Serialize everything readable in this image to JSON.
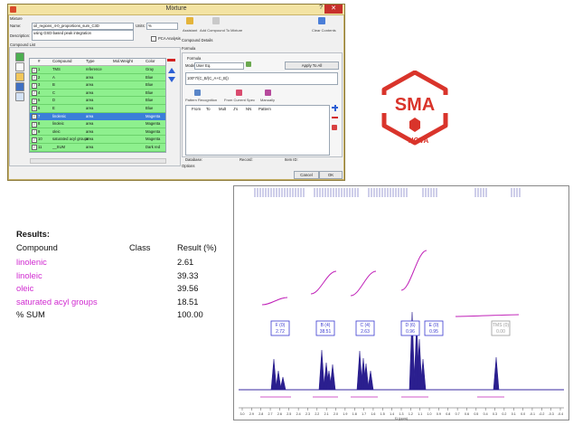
{
  "dialog": {
    "title": "Mixture",
    "help": "?",
    "close": "✕",
    "mixture_group": "Mixture",
    "name_label": "Name:",
    "name_value": "oil_regions_4-0_proportions_sum_C3D",
    "units_label": "Units:",
    "units_value": "%",
    "description_label": "Description:",
    "description_value": "using GSD-based peak integration",
    "pca_label": "PCA Analysis",
    "compound_list_label": "Compound List",
    "toolbar": {
      "assistant": "Assistant",
      "add_compound": "Add Compound To Mixture",
      "clear_contents": "Clear Contents"
    },
    "compound_details": "Compound Details",
    "formula": "Formula",
    "table_headers": {
      "num": "#",
      "compound": "Compound",
      "type": "Type",
      "molweight": "Mol.Weight",
      "color": "Color"
    },
    "rows": [
      {
        "num": "1",
        "compound": "TMS",
        "type": "reference",
        "color": "Gray"
      },
      {
        "num": "2",
        "compound": "A",
        "type": "area",
        "color": "Blue"
      },
      {
        "num": "3",
        "compound": "B",
        "type": "area",
        "color": "Blue"
      },
      {
        "num": "4",
        "compound": "C",
        "type": "area",
        "color": "Blue"
      },
      {
        "num": "5",
        "compound": "D",
        "type": "area",
        "color": "Blue"
      },
      {
        "num": "6",
        "compound": "E",
        "type": "area",
        "color": "Blue"
      },
      {
        "num": "7",
        "compound": "linolenic",
        "type": "area",
        "color": "Magenta"
      },
      {
        "num": "8",
        "compound": "linoleic",
        "type": "area",
        "color": "Magenta"
      },
      {
        "num": "9",
        "compound": "oleic",
        "type": "area",
        "color": "Magenta"
      },
      {
        "num": "10",
        "compound": "saturated acyl groups",
        "type": "area",
        "color": "Magenta"
      },
      {
        "num": "11",
        "compound": "__SUM",
        "type": "area",
        "color": "Dark red"
      }
    ],
    "formula_panel": {
      "formula_label": "Formula",
      "mode_label": "Mode:",
      "mode_value": "User Eq.",
      "apply_all": "Apply To All",
      "formula_text": "100*7/(C_B/(C_A+C_B))",
      "pattern_recognition": "Pattern Recognition",
      "from_current_spec": "From Current Spec",
      "manually": "Manually",
      "cols": [
        "From",
        "To",
        "Mult",
        "J's",
        "NN",
        "Pattern"
      ],
      "database_label": "Database:",
      "record_label": "Record:",
      "item_label": "Item ID:"
    },
    "options_label": "Options",
    "cancel": "Cancel",
    "ok": "OK"
  },
  "logo": {
    "text": "SMA",
    "sub": "NOVA",
    "color": "#d9342b"
  },
  "results": {
    "heading": "Results:",
    "headers": {
      "compound": "Compound",
      "class": "Class",
      "result": "Result (%)"
    },
    "rows": [
      {
        "compound": "linolenic",
        "result": "2.61",
        "highlight": true
      },
      {
        "compound": "linoleic",
        "result": "39.33",
        "highlight": true
      },
      {
        "compound": "oleic",
        "result": "39.56",
        "highlight": true
      },
      {
        "compound": "saturated acyl groups",
        "result": "18.51",
        "highlight": true
      },
      {
        "compound": "% SUM",
        "result": "100.00",
        "highlight": false
      }
    ]
  },
  "spectrum": {
    "box_labels": [
      {
        "top": "F (0)",
        "bottom": "2.72"
      },
      {
        "top": "B (4)",
        "bottom": "38.51"
      },
      {
        "top": "C (4)",
        "bottom": "2.63"
      },
      {
        "top": "D (6)",
        "bottom": "0.96"
      },
      {
        "top": "E (0)",
        "bottom": "0.95"
      },
      {
        "top": "TMS (0)",
        "bottom": "0.00"
      }
    ],
    "xticks": [
      "3.0",
      "2.9",
      "2.8",
      "2.7",
      "2.6",
      "2.5",
      "2.4",
      "2.3",
      "2.2",
      "2.1",
      "2.0",
      "1.9",
      "1.8",
      "1.7",
      "1.6",
      "1.5",
      "1.4",
      "1.3",
      "1.2",
      "1.1",
      "1.0",
      "0.9",
      "0.8",
      "0.7",
      "0.6",
      "0.5",
      "0.4",
      "0.3",
      "0.2",
      "0.1",
      "0.0",
      "-0.1",
      "-0.2",
      "-0.3",
      "-0.4"
    ],
    "xlabel": "f1 (ppm)"
  }
}
